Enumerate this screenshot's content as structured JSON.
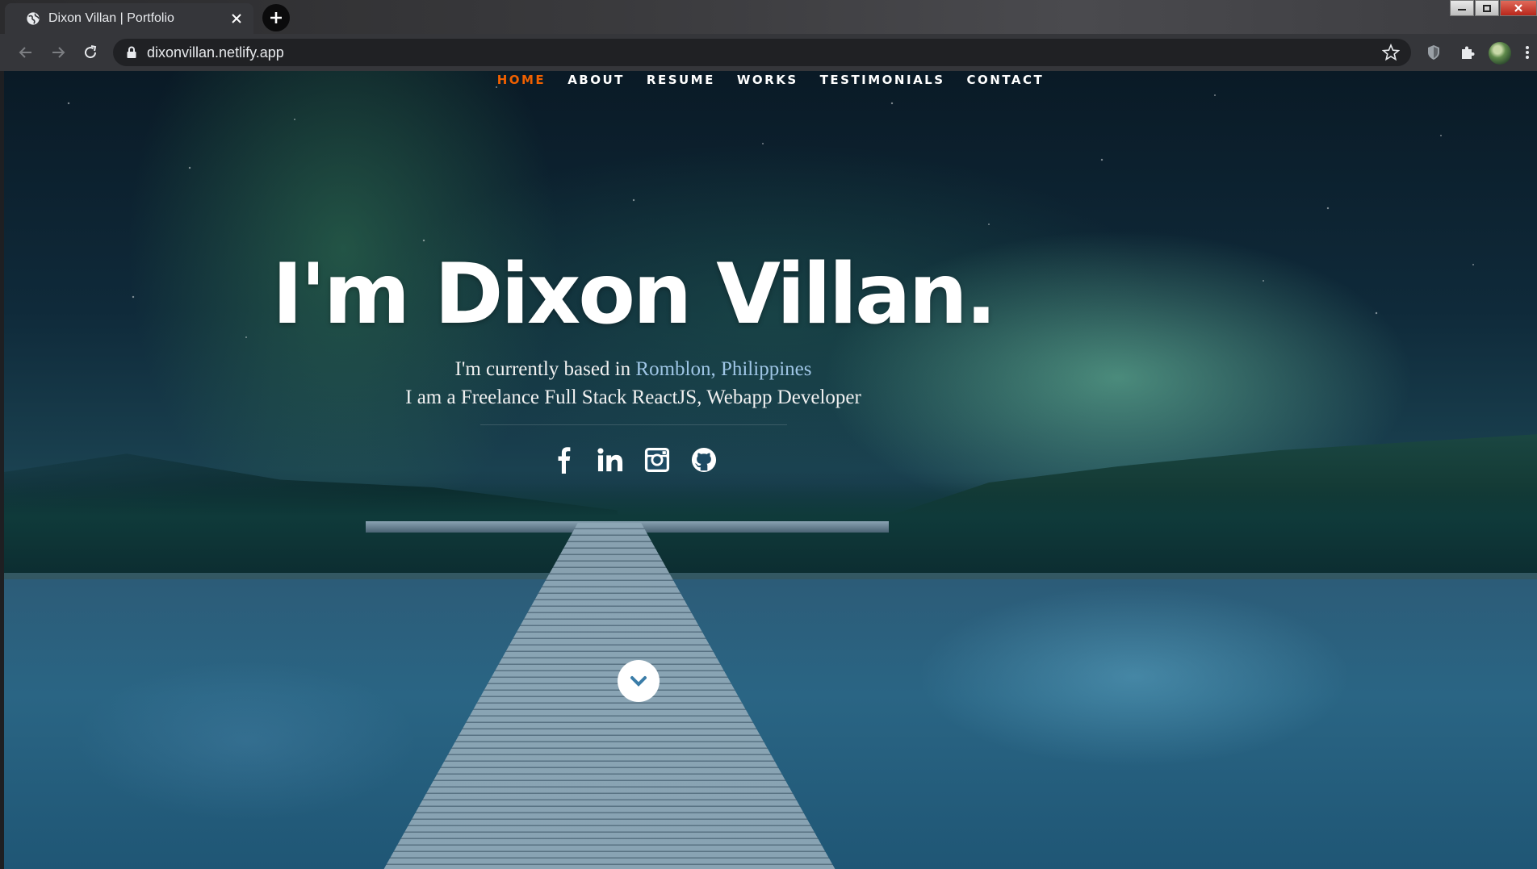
{
  "browser": {
    "tab_title": "Dixon Villan | Portfolio",
    "url": "dixonvillan.netlify.app"
  },
  "nav": {
    "items": [
      {
        "label": "HOME",
        "active": true
      },
      {
        "label": "ABOUT",
        "active": false
      },
      {
        "label": "RESUME",
        "active": false
      },
      {
        "label": "WORKS",
        "active": false
      },
      {
        "label": "TESTIMONIALS",
        "active": false
      },
      {
        "label": "CONTACT",
        "active": false
      }
    ],
    "active_color": "#f06000"
  },
  "hero": {
    "title": "I'm Dixon Villan.",
    "line1_prefix": "I'm currently based in",
    "line1_location": "Romblon, Philippines",
    "line2": "I am a Freelance Full Stack ReactJS, Webapp Developer"
  },
  "social": {
    "icons": [
      "facebook-icon",
      "linkedin-icon",
      "instagram-icon",
      "github-icon"
    ]
  },
  "colors": {
    "location_text": "#9fc6e6"
  }
}
